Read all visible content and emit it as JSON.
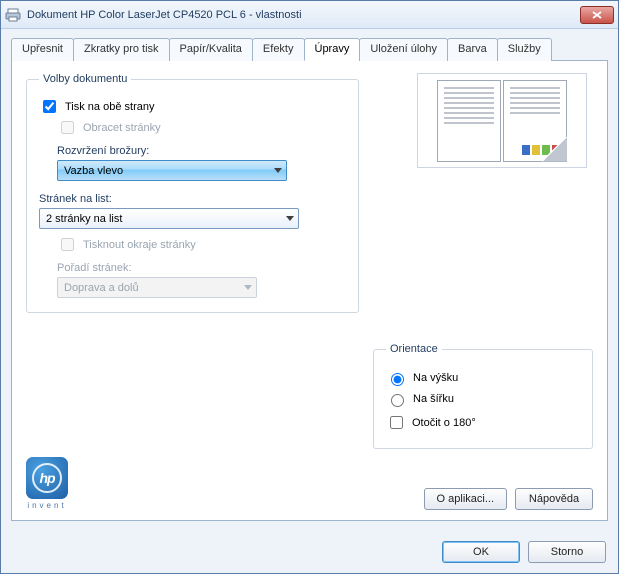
{
  "window": {
    "title": "Dokument HP Color LaserJet CP4520 PCL 6 - vlastnosti"
  },
  "tabs": [
    {
      "label": "Upřesnit"
    },
    {
      "label": "Zkratky pro tisk"
    },
    {
      "label": "Papír/Kvalita"
    },
    {
      "label": "Efekty"
    },
    {
      "label": "Úpravy"
    },
    {
      "label": "Uložení úlohy"
    },
    {
      "label": "Barva"
    },
    {
      "label": "Služby"
    }
  ],
  "doc_options": {
    "legend": "Volby dokumentu",
    "print_both_sides": {
      "label": "Tisk na obě strany",
      "checked": true
    },
    "flip_pages": {
      "label": "Obracet stránky",
      "checked": false,
      "enabled": false
    },
    "booklet_label": "Rozvržení brožury:",
    "booklet_value": "Vazba vlevo",
    "pages_per_sheet_label": "Stránek na list:",
    "pages_per_sheet_value": "2 stránky na list",
    "print_borders": {
      "label": "Tisknout okraje stránky",
      "checked": false,
      "enabled": false
    },
    "page_order_label": "Pořadí stránek:",
    "page_order_value": "Doprava a dolů"
  },
  "orientation": {
    "legend": "Orientace",
    "portrait": "Na výšku",
    "landscape": "Na šířku",
    "rotate": "Otočit o 180°",
    "selected": "portrait",
    "rotate_checked": false
  },
  "logo": {
    "invent": "invent"
  },
  "panel_buttons": {
    "about": "O aplikaci...",
    "help": "Nápověda"
  },
  "dialog_buttons": {
    "ok": "OK",
    "cancel": "Storno"
  }
}
